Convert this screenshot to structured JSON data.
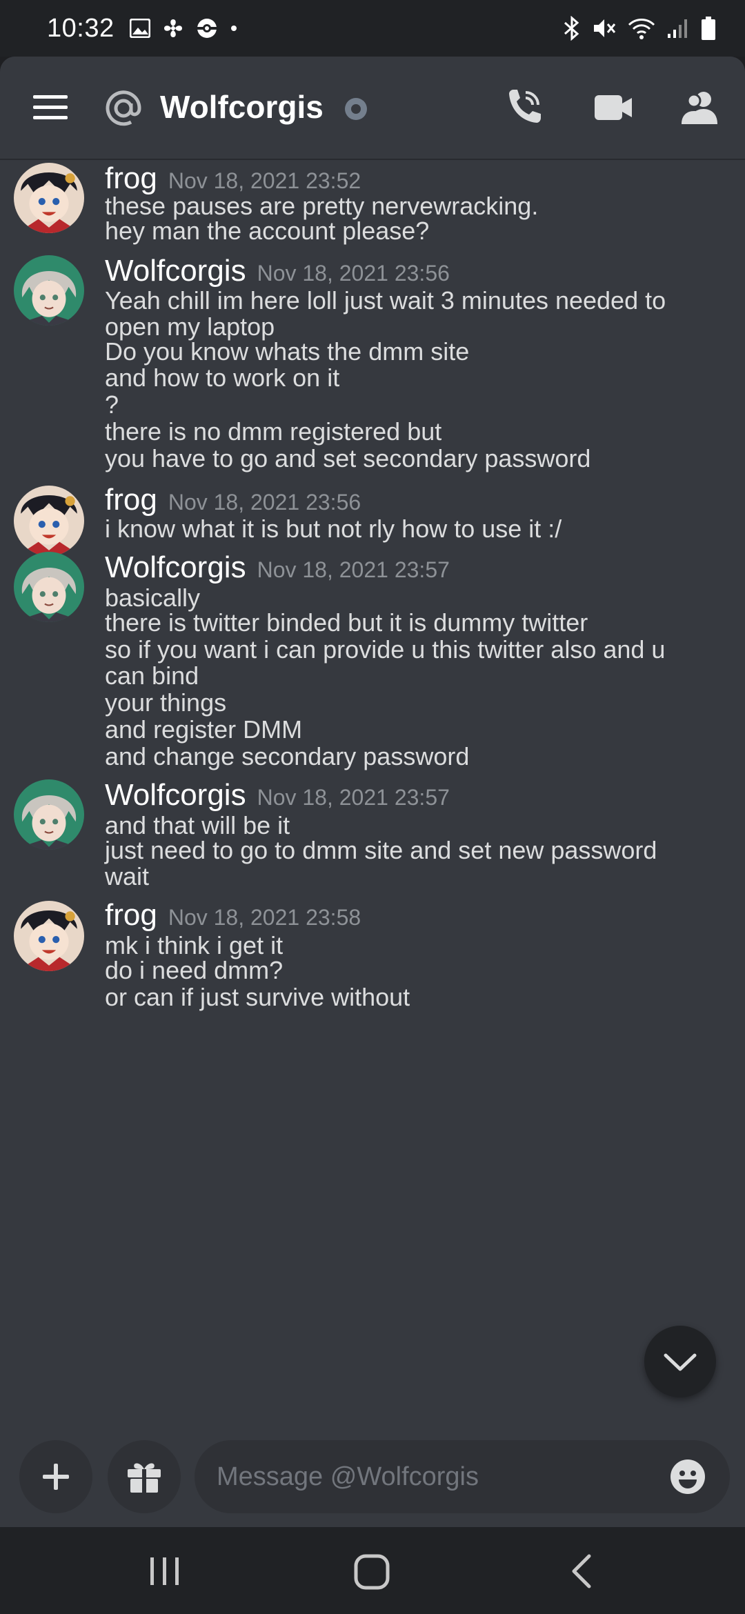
{
  "status_bar": {
    "time": "10:32"
  },
  "header": {
    "title": "Wolfcorgis"
  },
  "groups": [
    {
      "author": "frog",
      "timestamp": "Nov 18, 2021 23:52",
      "avatar": "frog",
      "lines": [
        "these pauses are pretty nervewracking.",
        "hey man the account please?"
      ]
    },
    {
      "author": "Wolfcorgis",
      "timestamp": "Nov 18, 2021 23:56",
      "avatar": "wolf",
      "lines": [
        "Yeah chill im here loll just wait 3 minutes needed to",
        "open my laptop",
        "Do you know whats the dmm site",
        "and how to work on it",
        "?",
        "there is no dmm registered but",
        "you have to go and set secondary password"
      ]
    },
    {
      "author": "frog",
      "timestamp": "Nov 18, 2021 23:56",
      "avatar": "frog",
      "lines": [
        "i know what it is but not rly how to use it :/"
      ]
    },
    {
      "author": "Wolfcorgis",
      "timestamp": "Nov 18, 2021 23:57",
      "avatar": "wolf",
      "lines": [
        "basically",
        "there is twitter binded but it is dummy twitter",
        "so if you want i can provide u this twitter also and u",
        "can bind",
        "your things",
        "and register DMM",
        "and change secondary password"
      ]
    },
    {
      "author": "Wolfcorgis",
      "timestamp": "Nov 18, 2021 23:57",
      "avatar": "wolf",
      "lines": [
        "and that will be it",
        "just need to go to dmm site and set new password",
        "wait"
      ]
    },
    {
      "author": "frog",
      "timestamp": "Nov 18, 2021 23:58",
      "avatar": "frog",
      "lines": [
        "mk i think i get it",
        "do i need dmm?",
        "or can if just survive without"
      ]
    }
  ],
  "composer": {
    "placeholder": "Message @Wolfcorgis"
  },
  "colors": {
    "background": "#36393f",
    "dark": "#202225",
    "input": "#2f3136",
    "text": "#dcddde",
    "muted": "#8e9297",
    "status_offline": "#747f8d"
  },
  "icons": {
    "menu": "hamburger-icon",
    "dm": "at-icon",
    "call": "phone-call-icon",
    "video": "video-camera-icon",
    "members": "members-icon",
    "add": "plus-icon",
    "gift": "gift-icon",
    "emoji": "emoji-icon",
    "scroll": "chevron-down-icon"
  }
}
